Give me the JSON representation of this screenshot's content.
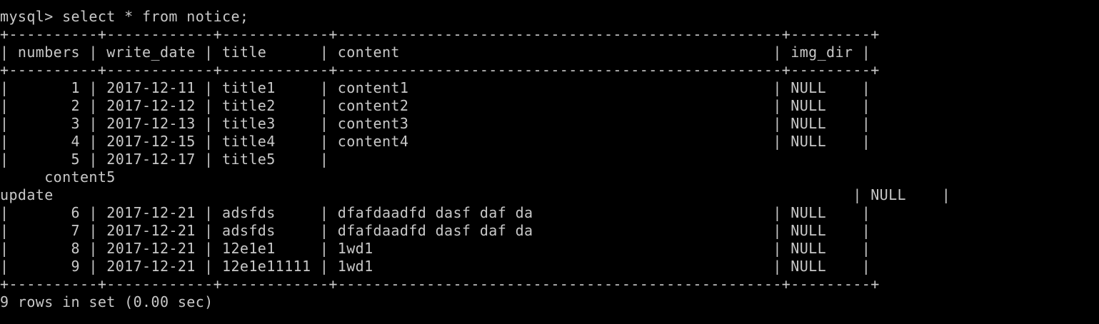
{
  "terminal": {
    "prompt_line": "mysql> select * from notice;",
    "border": "+----------+------------+------------+--------------------------------------------------+---------+",
    "header": "| numbers | write_date | title      | content                                          | img_dir |",
    "rows": [
      "|       1 | 2017-12-11 | title1     | content1                                         | NULL    |",
      "|       2 | 2017-12-12 | title2     | content2                                         | NULL    |",
      "|       3 | 2017-12-13 | title3     | content3                                         | NULL    |",
      "|       4 | 2017-12-15 | title4     | content4                                         | NULL    |",
      "|       5 | 2017-12-17 | title5     |",
      "     content5",
      "update                                                                                          | NULL    |",
      "|       6 | 2017-12-21 | adsfds     | dfafdaadfd dasf daf da                           | NULL    |",
      "|       7 | 2017-12-21 | adsfds     | dfafdaadfd dasf daf da                           | NULL    |",
      "|       8 | 2017-12-21 | 12e1e1     | 1wd1                                             | NULL    |",
      "|       9 | 2017-12-21 | 12e1e11111 | 1wd1                                             | NULL    |"
    ],
    "result_line": "9 rows in set (0.00 sec)"
  },
  "colors": {
    "background": "#000000",
    "text": "#c8c8c8"
  }
}
